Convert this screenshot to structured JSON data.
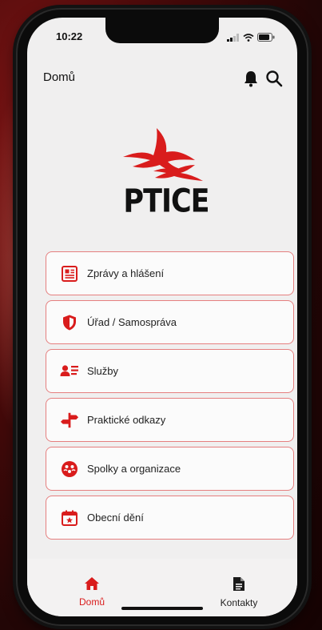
{
  "status": {
    "time": "10:22"
  },
  "header": {
    "title": "Domů"
  },
  "logo": {
    "text": "PTICE"
  },
  "menu": {
    "items": [
      {
        "label": "Zprávy a hlášení",
        "icon": "newspaper-icon"
      },
      {
        "label": "Úřad / Samospráva",
        "icon": "shield-icon"
      },
      {
        "label": "Služby",
        "icon": "person-list-icon"
      },
      {
        "label": "Praktické odkazy",
        "icon": "signpost-icon"
      },
      {
        "label": "Spolky a organizace",
        "icon": "group-icon"
      },
      {
        "label": "Obecní dění",
        "icon": "calendar-star-icon"
      }
    ]
  },
  "tabbar": {
    "tabs": [
      {
        "label": "Domů",
        "icon": "home-icon",
        "active": true
      },
      {
        "label": "Kontakty",
        "icon": "document-icon",
        "active": false
      }
    ]
  },
  "colors": {
    "accent": "#d91c1c",
    "border": "#e57f7f",
    "background": "#f0efef"
  }
}
